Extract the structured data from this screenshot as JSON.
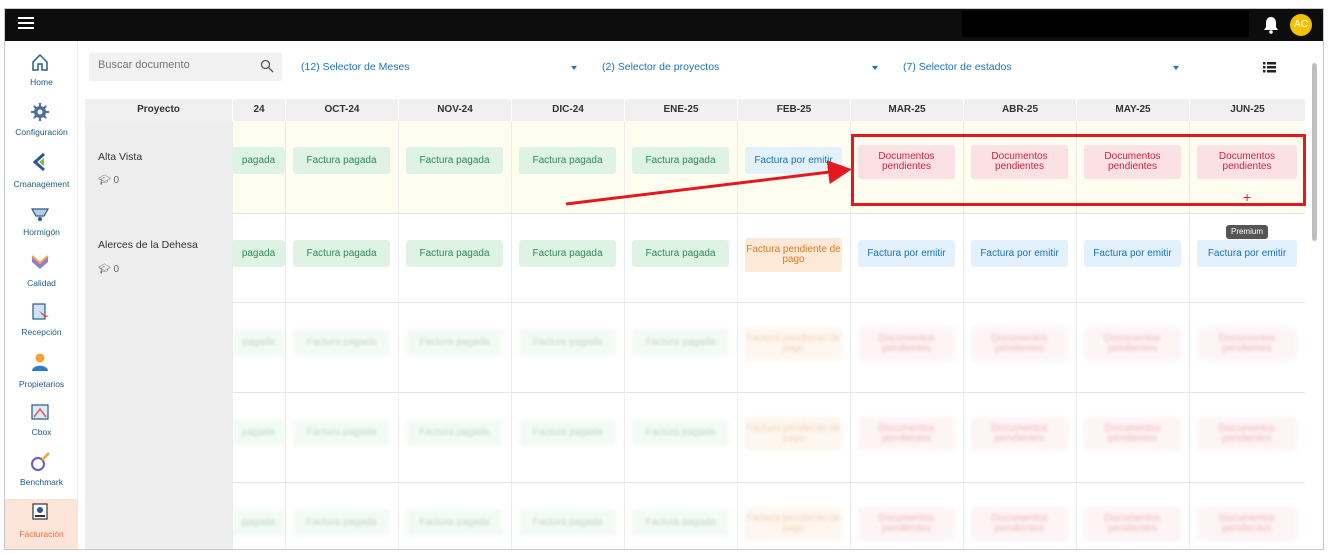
{
  "topbar": {
    "menu_icon": "hamburger-icon",
    "bell_icon": "bell-icon",
    "avatar_initials": "AC"
  },
  "sidebar": {
    "items": [
      {
        "label": "Home",
        "icon": "home-icon"
      },
      {
        "label": "Configuración",
        "icon": "gear-icon"
      },
      {
        "label": "Cmanagement",
        "icon": "chevron-icon"
      },
      {
        "label": "Hormigón",
        "icon": "wheelbarrow-icon"
      },
      {
        "label": "Calidad",
        "icon": "check-icon"
      },
      {
        "label": "Recepción",
        "icon": "reception-icon"
      },
      {
        "label": "Propietarios",
        "icon": "people-icon"
      },
      {
        "label": "Cbox",
        "icon": "box-icon"
      },
      {
        "label": "Benchmark",
        "icon": "benchmark-icon"
      },
      {
        "label": "Facturación",
        "icon": "invoice-icon",
        "active": true
      }
    ]
  },
  "toolbar": {
    "search_placeholder": "Buscar documento",
    "selectors": [
      {
        "label": "(12) Selector de Meses"
      },
      {
        "label": "(2) Selector de proyectos"
      },
      {
        "label": "(7) Selector de estados"
      }
    ]
  },
  "table": {
    "project_header": "Proyecto",
    "months": [
      "24",
      "OCT-24",
      "NOV-24",
      "DIC-24",
      "ENE-25",
      "FEB-25",
      "MAR-25",
      "ABR-25",
      "MAY-25",
      "JUN-25"
    ],
    "projects": [
      {
        "name": "Alta Vista",
        "count": "0",
        "cells": [
          {
            "text": "pagada",
            "status": "green"
          },
          {
            "text": "Factura pagada",
            "status": "green"
          },
          {
            "text": "Factura pagada",
            "status": "green"
          },
          {
            "text": "Factura pagada",
            "status": "green"
          },
          {
            "text": "Factura pagada",
            "status": "green"
          },
          {
            "text": "Factura por emitir",
            "status": "blue"
          },
          {
            "text": "Documentos pendientes",
            "status": "red"
          },
          {
            "text": "Documentos pendientes",
            "status": "red"
          },
          {
            "text": "Documentos pendientes",
            "status": "red"
          },
          {
            "text": "Documentos pendientes",
            "status": "red"
          }
        ]
      },
      {
        "name": "Alerces de la Dehesa",
        "count": "0",
        "cells": [
          {
            "text": "pagada",
            "status": "green"
          },
          {
            "text": "Factura pagada",
            "status": "green"
          },
          {
            "text": "Factura pagada",
            "status": "green"
          },
          {
            "text": "Factura pagada",
            "status": "green"
          },
          {
            "text": "Factura pagada",
            "status": "green"
          },
          {
            "text": "Factura pendiente de pago",
            "status": "orange"
          },
          {
            "text": "Factura por emitir",
            "status": "blue"
          },
          {
            "text": "Factura por emitir",
            "status": "blue"
          },
          {
            "text": "Factura por emitir",
            "status": "blue"
          },
          {
            "text": "Factura por emitir",
            "status": "blue"
          }
        ]
      }
    ],
    "add_symbol": "+",
    "tooltip": "Premium"
  },
  "colors": {
    "accent": "#1a73b8",
    "highlight": "#e3191f",
    "active_nav": "#e8723c"
  }
}
